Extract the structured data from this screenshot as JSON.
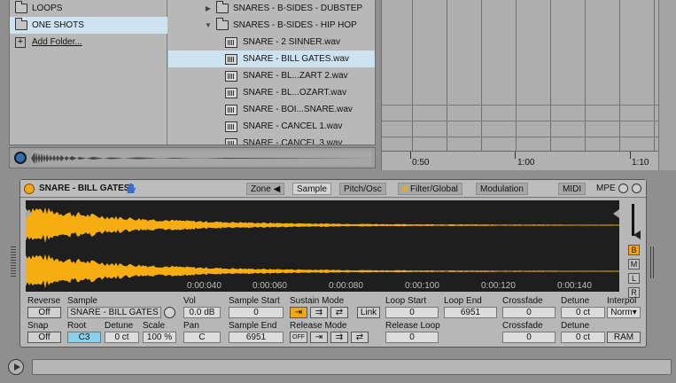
{
  "browser": {
    "places": [
      {
        "label": "LOOPS",
        "selected": false
      },
      {
        "label": "ONE SHOTS",
        "selected": true
      }
    ],
    "add_folder": "Add Folder...",
    "files": [
      {
        "label": "SNARES - B-SIDES - DUBSTEP",
        "kind": "folder",
        "expanded": false
      },
      {
        "label": "SNARES - B-SIDES - HIP HOP",
        "kind": "folder",
        "expanded": true
      },
      {
        "label": "SNARE - 2 SINNER.wav",
        "kind": "file"
      },
      {
        "label": "SNARE - BILL GATES.wav",
        "kind": "file",
        "selected": true
      },
      {
        "label": "SNARE - BL...ZART 2.wav",
        "kind": "file"
      },
      {
        "label": "SNARE - BL...OZART.wav",
        "kind": "file"
      },
      {
        "label": "SNARE - BOI...SNARE.wav",
        "kind": "file"
      },
      {
        "label": "SNARE - CANCEL 1.wav",
        "kind": "file"
      },
      {
        "label": "SNARE - CANCEL 3.wav",
        "kind": "file"
      }
    ]
  },
  "arrangement": {
    "ruler": [
      "0:50",
      "1:00",
      "1:10"
    ]
  },
  "device": {
    "title": "SNARE - BILL GATES",
    "tabs": [
      "Zone",
      "Sample",
      "Pitch/Osc",
      "Filter/Global",
      "Modulation",
      "MIDI",
      "MPE"
    ],
    "active_tab": "Sample",
    "timeline": [
      "0:00:040",
      "0:00:060",
      "0:00:080",
      "0:00:100",
      "0:00:120",
      "0:00:140"
    ],
    "side_buttons": [
      "B",
      "M",
      "L",
      "R"
    ],
    "controls": {
      "reverse_label": "Reverse",
      "reverse_value": "Off",
      "snap_label": "Snap",
      "snap_value": "Off",
      "sample_label": "Sample",
      "sample_value": "SNARE - BILL GATES",
      "root_label": "Root",
      "root_value": "C3",
      "detune_label": "Detune",
      "detune_value": "0 ct",
      "scale_label": "Scale",
      "scale_value": "100 %",
      "vol_label": "Vol",
      "vol_value": "0.0 dB",
      "pan_label": "Pan",
      "pan_value": "C",
      "sample_start_label": "Sample Start",
      "sample_start_value": "0",
      "sample_end_label": "Sample End",
      "sample_end_value": "6951",
      "sustain_mode_label": "Sustain Mode",
      "link_label": "Link",
      "release_mode_label": "Release Mode",
      "release_off": "OFF",
      "loop_start_label": "Loop Start",
      "loop_start_value": "0",
      "loop_end_label": "Loop End",
      "loop_end_value": "6951",
      "release_loop_label": "Release Loop",
      "release_loop_value": "0",
      "crossfade_label": "Crossfade",
      "crossfade_value": "0",
      "crossfade2_value": "0",
      "detune2_label": "Detune",
      "detune2_value": "0 ct",
      "detune3_value": "0 ct",
      "interpol_label": "Interpol",
      "interpol_value": "Norm▾",
      "ram_label": "RAM"
    },
    "colors": {
      "accent": "#f1a716",
      "wave": "#f5ad12",
      "selected_blue": "#89d1ea"
    }
  }
}
